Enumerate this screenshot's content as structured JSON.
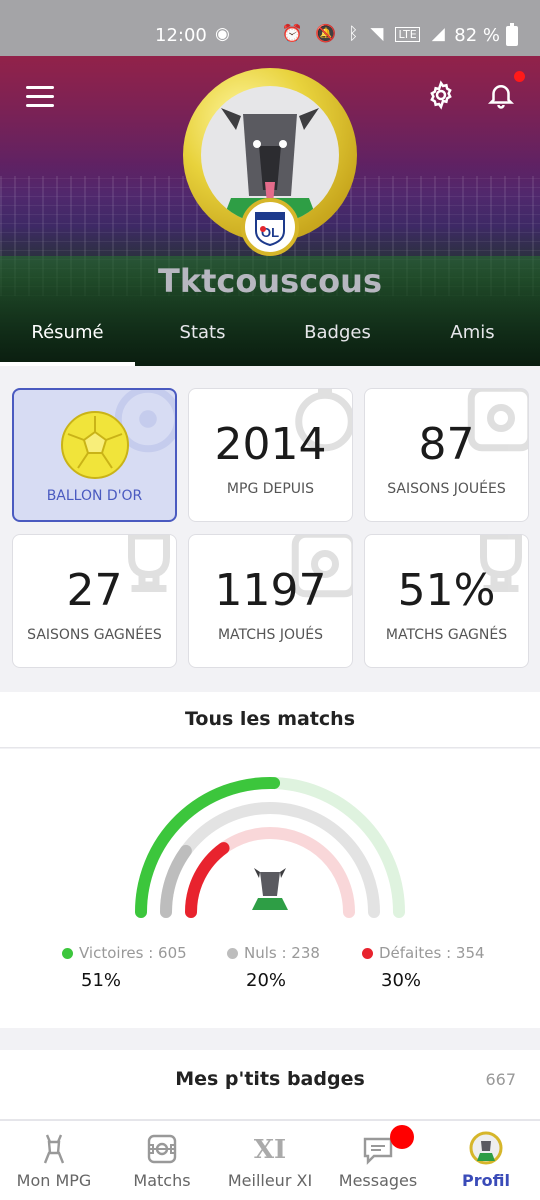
{
  "status_bar": {
    "time": "12:00",
    "battery": "82 %"
  },
  "profile": {
    "username": "Tktcouscous",
    "club": "Olympique Lyonnais"
  },
  "tabs": [
    {
      "label": "Résumé",
      "active": true
    },
    {
      "label": "Stats",
      "active": false
    },
    {
      "label": "Badges",
      "active": false
    },
    {
      "label": "Amis",
      "active": false
    }
  ],
  "cards": [
    {
      "value": "",
      "label": "BALLON D'OR",
      "highlight": true
    },
    {
      "value": "2014",
      "label": "MPG DEPUIS"
    },
    {
      "value": "87",
      "label": "SAISONS JOUÉES"
    },
    {
      "value": "27",
      "label": "SAISONS GAGNÉES"
    },
    {
      "value": "1197",
      "label": "MATCHS JOUÉS"
    },
    {
      "value": "51%",
      "label": "MATCHS GAGNÉS"
    }
  ],
  "all_matches": {
    "title": "Tous les matchs",
    "victories": {
      "label": "Victoires : 605",
      "pct": "51%",
      "fraction": 0.51,
      "color": "#3cc63c"
    },
    "draws": {
      "label": "Nuls : 238",
      "pct": "20%",
      "fraction": 0.2,
      "color": "#bdbdbd"
    },
    "defeats": {
      "label": "Défaites : 354",
      "pct": "30%",
      "fraction": 0.3,
      "color": "#e8232e"
    }
  },
  "badges_section": {
    "title": "Mes p'tits badges",
    "count": "667"
  },
  "bottom_nav": [
    {
      "label": "Mon MPG",
      "icon": "goat-icon",
      "active": false
    },
    {
      "label": "Matchs",
      "icon": "pitch-icon",
      "active": false
    },
    {
      "label": "Meilleur XI",
      "icon": "xi-icon",
      "active": false
    },
    {
      "label": "Messages",
      "icon": "chat-icon",
      "active": false,
      "badge": true
    },
    {
      "label": "Profil",
      "icon": "profile-badge-icon",
      "active": true
    }
  ],
  "colors": {
    "accent": "#3a4bb8",
    "notification": "#ff1a1a",
    "gold": "#e8d23c"
  }
}
